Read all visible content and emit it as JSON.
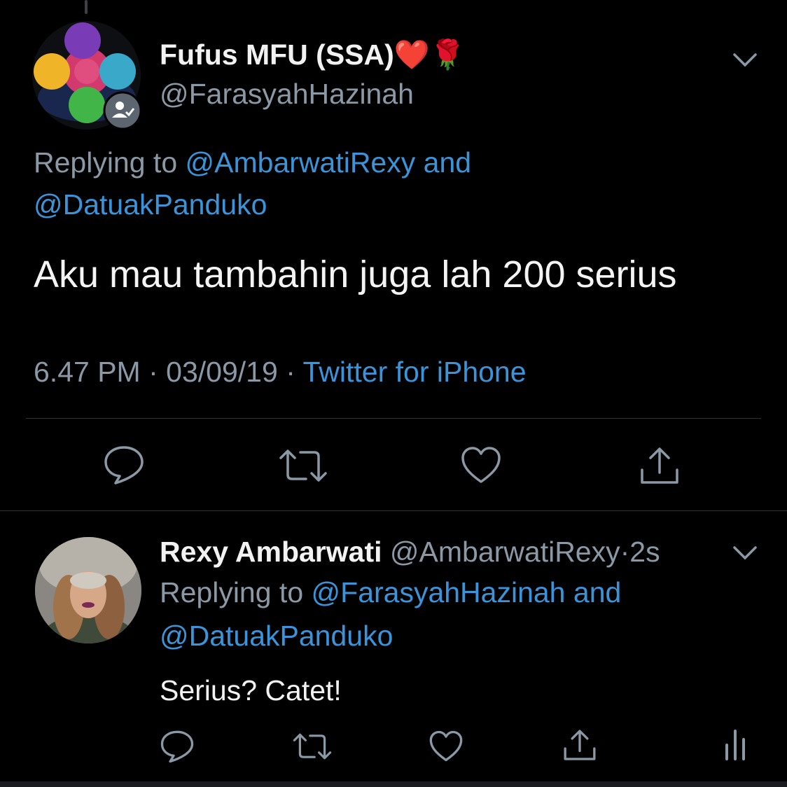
{
  "main_tweet": {
    "display_name": "Fufus MFU (SSA)",
    "name_emojis": [
      "❤️",
      "🌹"
    ],
    "handle": "@FarasyahHazinah",
    "replying_prefix": "Replying to",
    "replying_user1": "@AmbarwatiRexy",
    "replying_and": "and",
    "replying_user2": "@DatuakPanduko",
    "text": "Aku mau tambahin juga lah 200 serius",
    "time": "6.47 PM",
    "separator": "·",
    "date": "03/09/19",
    "source": "Twitter for iPhone",
    "avatar_icon": "colorful-circles-avatar",
    "badge_icon": "user-check-icon"
  },
  "reply_tweet": {
    "display_name": "Rexy Ambarwati",
    "handle": "@AmbarwatiRexy",
    "separator": "·",
    "time_ago": "2s",
    "replying_prefix": "Replying to",
    "replying_user1": "@FarasyahHazinah",
    "replying_and": "and",
    "replying_user2": "@DatuakPanduko",
    "text": "Serius? Catet!",
    "avatar_icon": "fur-hood-photo-avatar"
  },
  "actions": {
    "reply_icon": "reply-icon",
    "retweet_icon": "retweet-icon",
    "like_icon": "heart-icon",
    "share_icon": "share-icon",
    "analytics_icon": "analytics-icon",
    "more_icon": "chevron-down-icon"
  },
  "colors": {
    "background": "#000000",
    "text": "#f2f2f2",
    "muted": "#8b98a5",
    "link": "#3b94d9",
    "divider": "#2f3336"
  }
}
